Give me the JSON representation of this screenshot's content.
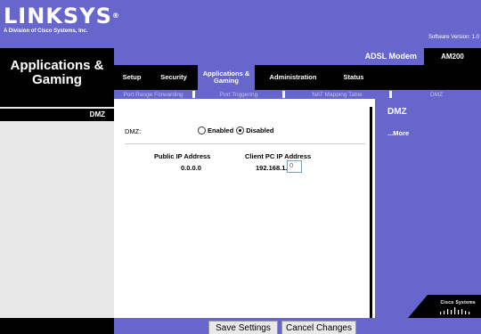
{
  "header": {
    "brand": "LINKSYS",
    "brand_mark": "®",
    "subtitle": "A Division of Cisco Systems, Inc.",
    "software_version": "Software Version: 1.0"
  },
  "section_title": "Applications & Gaming",
  "product": {
    "name": "ADSL Modem",
    "model": "AM200"
  },
  "tabs": [
    {
      "label": "Setup"
    },
    {
      "label": "Security"
    },
    {
      "label": "Applications & Gaming",
      "active": true
    },
    {
      "label": "Administration"
    },
    {
      "label": "Status"
    }
  ],
  "subtabs": [
    {
      "label": "Port Range Forwarding"
    },
    {
      "label": "Port Triggering"
    },
    {
      "label": "NAT Mapping Table"
    },
    {
      "label": "DMZ",
      "active": true
    }
  ],
  "sidebar": {
    "label": "DMZ"
  },
  "dmz": {
    "field_label": "DMZ:",
    "enabled_label": "Enabled",
    "disabled_label": "Disabled",
    "selected": "Disabled",
    "public_ip_header": "Public IP Address",
    "client_ip_header": "Client PC IP Address",
    "public_ip_value": "0.0.0.0",
    "client_ip_prefix": "192.168.1.",
    "client_ip_last_octet": "0"
  },
  "help": {
    "title": "DMZ",
    "more_link": "...More"
  },
  "footer_logo": "Cisco Systems",
  "buttons": {
    "save": "Save Settings",
    "cancel": "Cancel Changes"
  },
  "colors": {
    "accent": "#6666cc",
    "black": "#000000",
    "sidebar_gray": "#e7e7e7"
  }
}
